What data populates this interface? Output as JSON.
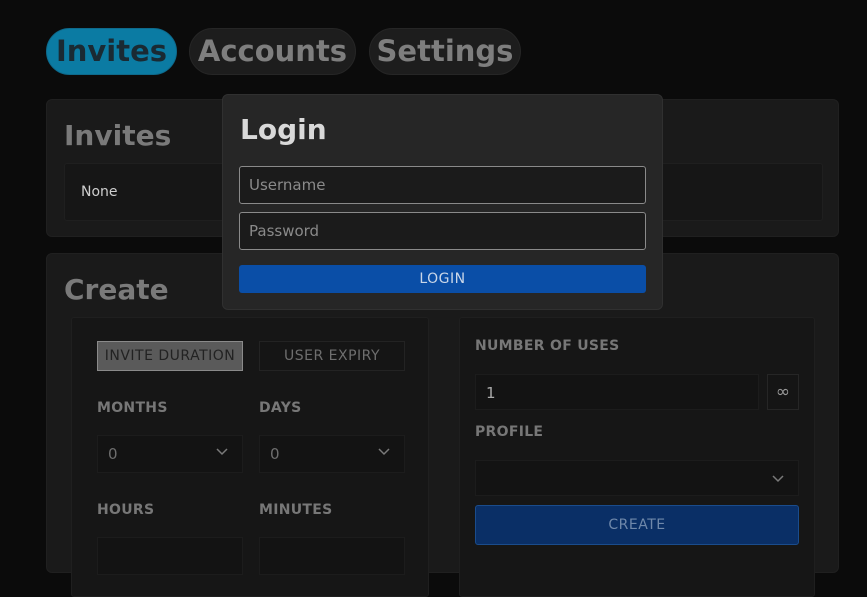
{
  "tabs": [
    {
      "label": "Invites",
      "active": true
    },
    {
      "label": "Accounts",
      "active": false
    },
    {
      "label": "Settings",
      "active": false
    }
  ],
  "invites": {
    "title": "Invites",
    "empty_text": "None"
  },
  "create": {
    "title": "Create",
    "toggle": {
      "invite_duration": "INVITE DURATION",
      "user_expiry": "USER EXPIRY"
    },
    "months": {
      "label": "MONTHS",
      "value": "0"
    },
    "days": {
      "label": "DAYS",
      "value": "0"
    },
    "hours": {
      "label": "HOURS"
    },
    "minutes": {
      "label": "MINUTES"
    },
    "uses": {
      "label": "NUMBER OF USES",
      "value": "1",
      "infinite_symbol": "∞"
    },
    "profile": {
      "label": "PROFILE",
      "value": ""
    },
    "create_button": "CREATE"
  },
  "login_modal": {
    "title": "Login",
    "username_placeholder": "Username",
    "password_placeholder": "Password",
    "login_button": "LOGIN"
  },
  "colors": {
    "accent_tab": "#0b7ba3",
    "login_button": "#0a4ea7",
    "create_button": "#0a2f66"
  },
  "icons": [
    "chevron-down-icon",
    "infinity-icon"
  ]
}
